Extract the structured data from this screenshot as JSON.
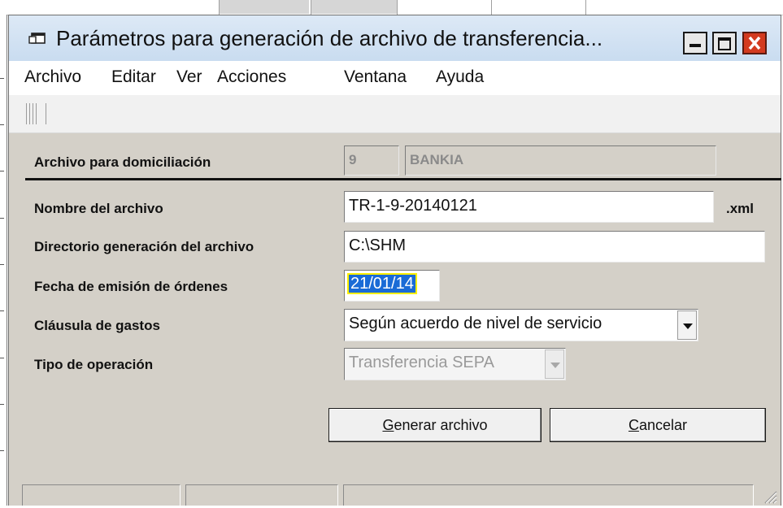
{
  "window": {
    "title": "Parámetros para generación de archivo de transferencia...",
    "title_icon": "window-icon",
    "buttons": [
      "minimize-icon",
      "maximize-icon",
      "close-icon"
    ]
  },
  "menu": {
    "items": [
      "Archivo",
      "Editar",
      "Ver",
      "Acciones",
      "Ventana",
      "Ayuda"
    ]
  },
  "form": {
    "domiciliacion": {
      "label": "Archivo para domiciliación",
      "code": "9",
      "bank": "BANKIA"
    },
    "nombre": {
      "label": "Nombre del archivo",
      "value": "TR-1-9-20140121",
      "ext": ".xml"
    },
    "directorio": {
      "label": "Directorio generación del archivo",
      "value": "C:\\SHM"
    },
    "fecha": {
      "label": "Fecha de emisión de órdenes",
      "value": "21/01/14"
    },
    "clausula": {
      "label": "Cláusula de gastos",
      "value": "Según acuerdo de nivel de servicio"
    },
    "tipo": {
      "label": "Tipo de operación",
      "value": "Transferencia SEPA"
    }
  },
  "buttons": {
    "generate_rest": "enerar archivo",
    "cancel_rest": "ancelar",
    "generate_hotkey": "G",
    "cancel_hotkey": "C"
  },
  "colors": {
    "selection": "#1a6bd6",
    "close_button": "#d33a1f",
    "dialog_face": "#d4d0c8"
  }
}
